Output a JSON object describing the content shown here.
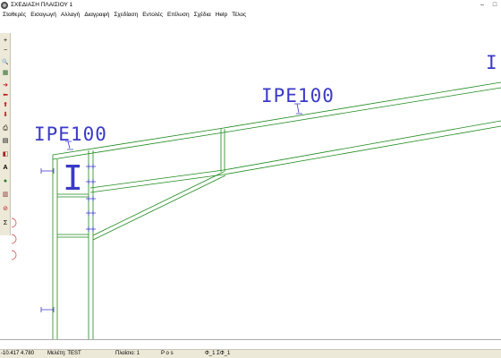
{
  "window": {
    "title": "ΣΧΕΔΙΑΣΗ ΠΛΑΙΣΙΟΥ 1"
  },
  "window_controls": {
    "minimize": "–",
    "maximize": "□"
  },
  "menu": [
    "Σταθερές",
    "Εισαγωγή",
    "Αλλαγή",
    "Διαγραφή",
    "Σχεδίαση",
    "Εντολές",
    "Επίλυση",
    "Σχέδια",
    "Help",
    "Τέλος"
  ],
  "toolbar": [
    {
      "icon": "plus-icon",
      "glyph": "+"
    },
    {
      "icon": "minus-icon",
      "glyph": "−"
    },
    {
      "icon": "zoom-icon",
      "glyph": "🔍"
    },
    {
      "icon": "grid-icon",
      "glyph": "▦"
    },
    {
      "icon": "arrow-right-icon",
      "glyph": "➜"
    },
    {
      "icon": "arrow-left-icon",
      "glyph": "⬅"
    },
    {
      "icon": "arrow-up-icon",
      "glyph": "⬆"
    },
    {
      "icon": "arrow-down-icon",
      "glyph": "⬇"
    },
    {
      "icon": "print-icon",
      "glyph": "⎙"
    },
    {
      "icon": "document-icon",
      "glyph": "▤"
    },
    {
      "icon": "layers-icon",
      "glyph": "◧"
    },
    {
      "icon": "text-icon",
      "glyph": "A"
    },
    {
      "icon": "globe-icon",
      "glyph": "●"
    },
    {
      "icon": "chart-icon",
      "glyph": "▥"
    },
    {
      "icon": "stop-icon",
      "glyph": "⊘"
    },
    {
      "icon": "sum-icon",
      "glyph": "Σ"
    }
  ],
  "drawing": {
    "labels": [
      "IPE100",
      "IPE100",
      "I"
    ]
  },
  "status": {
    "coords": "-10.417  4.780",
    "study": "Μελέτη: TEST",
    "frame": "Πλαίσιο: 1",
    "pos": "P o s",
    "phi": "Φ_1  ΣΦ_1"
  },
  "colors": {
    "beam": "#1c8a1c",
    "label": "#3a3ac8",
    "dim": "#3a3ac8",
    "arc": "#d04040"
  }
}
